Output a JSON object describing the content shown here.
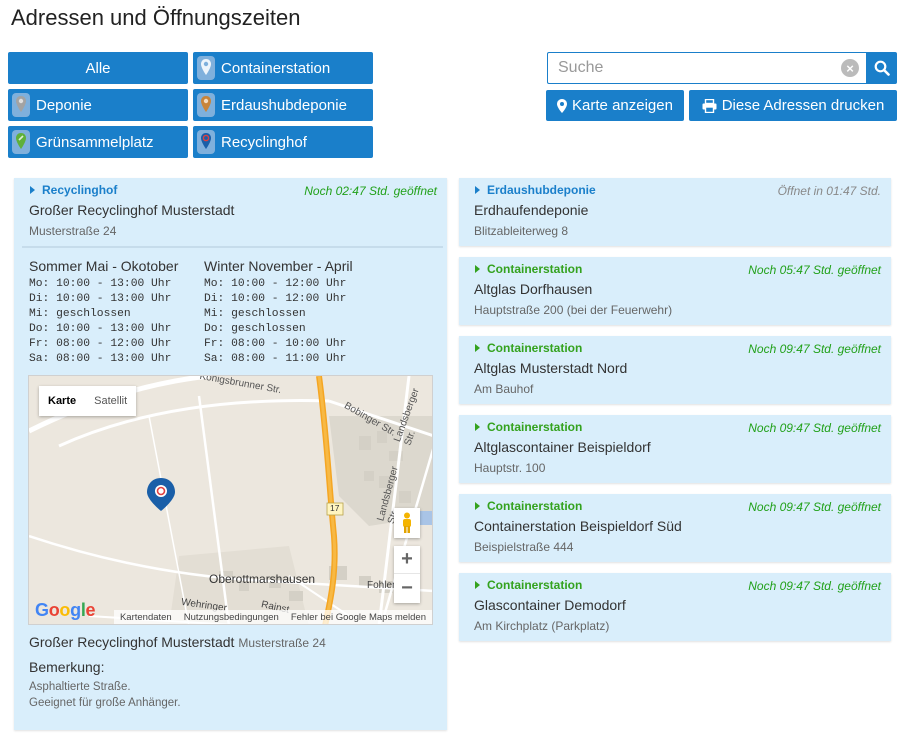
{
  "page": {
    "title": "Adressen und Öffnungszeiten"
  },
  "filters": [
    {
      "label": "Alle",
      "pin": null
    },
    {
      "label": "Containerstation",
      "pin": "#6b9fd0"
    },
    {
      "label": "Deponie",
      "pin": "#a3a3a3"
    },
    {
      "label": "Erdaushubdeponie",
      "pin": "#c8843a"
    },
    {
      "label": "Grünsammelplatz",
      "pin": "#5fb03a"
    },
    {
      "label": "Recyclinghof",
      "pin": "#1a7fca"
    }
  ],
  "search": {
    "placeholder": "Suche",
    "clear": "×"
  },
  "actions": {
    "map": "Karte anzeigen",
    "print": "Diese Adressen drucken"
  },
  "expanded": {
    "category": "Recyclinghof",
    "status": "Noch 02:47 Std. geöffnet",
    "name": "Großer Recyclinghof Musterstadt",
    "address": "Musterstraße 24",
    "summer": {
      "title": "Sommer Mai - Okotober",
      "lines": [
        "Mo: 10:00 - 13:00 Uhr",
        "Di: 10:00 - 13:00 Uhr",
        "Mi: geschlossen",
        "Do: 10:00 - 13:00 Uhr",
        "Fr: 08:00 - 12:00 Uhr",
        "Sa: 08:00 - 13:00 Uhr"
      ]
    },
    "winter": {
      "title": "Winter November - April",
      "lines": [
        "Mo: 10:00 - 12:00 Uhr",
        "Di: 10:00 - 12:00 Uhr",
        "Mi: geschlossen",
        "Do: geschlossen",
        "Fr: 08:00 - 10:00 Uhr",
        "Sa: 08:00 - 11:00 Uhr"
      ]
    },
    "map": {
      "tab_map": "Karte",
      "tab_satellite": "Satellit",
      "labels": [
        "Königsbrunner Str.",
        "Bobinger Str.",
        "Landsberger Str.",
        "Landsberger Str.",
        "Oberottmarshausen",
        "Fohlen",
        "Wehringer",
        "Rainst",
        "17"
      ],
      "google": "Google",
      "footer": [
        "Kartendaten",
        "Nutzungsbedingungen",
        "Fehler bei Google Maps melden"
      ]
    },
    "footer_name": "Großer Recyclinghof Musterstadt",
    "footer_address": "Musterstraße 24",
    "remark_title": "Bemerkung:",
    "remark_lines": [
      "Asphaltierte Straße.",
      "Geeignet für große Anhänger."
    ]
  },
  "locations": [
    {
      "category": "Erdaushubdeponie",
      "category_color": "blue",
      "status": "Öffnet in 01:47 Std.",
      "status_color": "grey",
      "name": "Erdhaufendeponie",
      "address": "Blitzableiterweg 8"
    },
    {
      "category": "Containerstation",
      "category_color": "green",
      "status": "Noch 05:47 Std. geöffnet",
      "status_color": "green",
      "name": "Altglas Dorfhausen",
      "address": "Hauptstraße 200 (bei der Feuerwehr)"
    },
    {
      "category": "Containerstation",
      "category_color": "green",
      "status": "Noch 09:47 Std. geöffnet",
      "status_color": "green",
      "name": "Altglas Musterstadt Nord",
      "address": "Am Bauhof"
    },
    {
      "category": "Containerstation",
      "category_color": "green",
      "status": "Noch 09:47 Std. geöffnet",
      "status_color": "green",
      "name": "Altglascontainer Beispieldorf",
      "address": "Hauptstr. 100"
    },
    {
      "category": "Containerstation",
      "category_color": "green",
      "status": "Noch 09:47 Std. geöffnet",
      "status_color": "green",
      "name": "Containerstation Beispieldorf Süd",
      "address": "Beispielstraße 444"
    },
    {
      "category": "Containerstation",
      "category_color": "green",
      "status": "Noch 09:47 Std. geöffnet",
      "status_color": "green",
      "name": "Glascontainer Demodorf",
      "address": "Am Kirchplatz (Parkplatz)"
    }
  ]
}
